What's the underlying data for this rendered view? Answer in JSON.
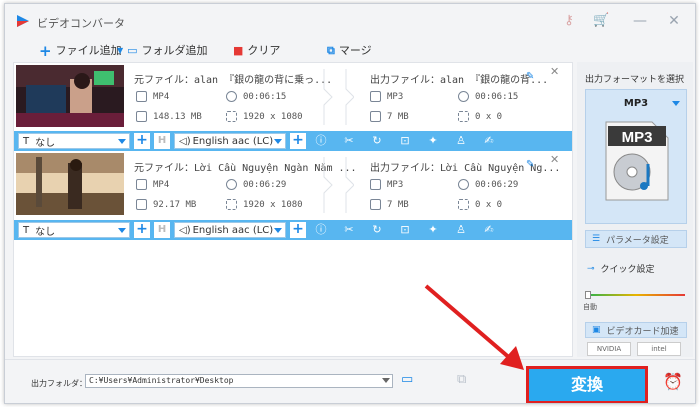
{
  "app": {
    "title": "ビデオコンバータ"
  },
  "toolbar": {
    "add_file": "ファイル追加",
    "add_folder": "フォルダ追加",
    "clear": "クリア",
    "merge": "マージ"
  },
  "items": [
    {
      "source_label": "元ファイル：alan 『銀の龍の背に乗っ...",
      "source_format": "MP4",
      "source_duration": "00:06:15",
      "source_size": "148.13 MB",
      "source_resolution": "1920 x 1080",
      "output_label": "出力ファイル：alan 『銀の龍の背...",
      "output_format": "MP3",
      "output_duration": "00:06:15",
      "output_size": "7 MB",
      "output_resolution": "0 x 0",
      "subtitle": "なし",
      "audio": "English aac (LC)"
    },
    {
      "source_label": "元ファイル：Lời Cầu Nguyện Ngàn Năm ...",
      "source_format": "MP4",
      "source_duration": "00:06:29",
      "source_size": "92.17 MB",
      "source_resolution": "1920 x 1080",
      "output_label": "出力ファイル：Lời Cầu Nguyện Ng...",
      "output_format": "MP3",
      "output_duration": "00:06:29",
      "output_size": "7 MB",
      "output_resolution": "0 x 0",
      "subtitle": "なし",
      "audio": "English aac (LC)"
    }
  ],
  "right_panel": {
    "select_format": "出力フォーマットを選択",
    "format": "MP3",
    "format_icon_text": "MP3",
    "params": "パラメータ設定",
    "quick": "クイック設定",
    "auto": "自動",
    "gpu": "ビデオカード加速",
    "nvidia": "NVIDIA",
    "intel": "intel"
  },
  "bottom": {
    "output_folder_label": "出力フォルダ：",
    "output_path": "C:¥Users¥Administrator¥Desktop",
    "convert": "変換"
  },
  "colors": {
    "accent": "#2aa9ef",
    "bar": "#58b6f0",
    "highlight": "#e02020"
  }
}
